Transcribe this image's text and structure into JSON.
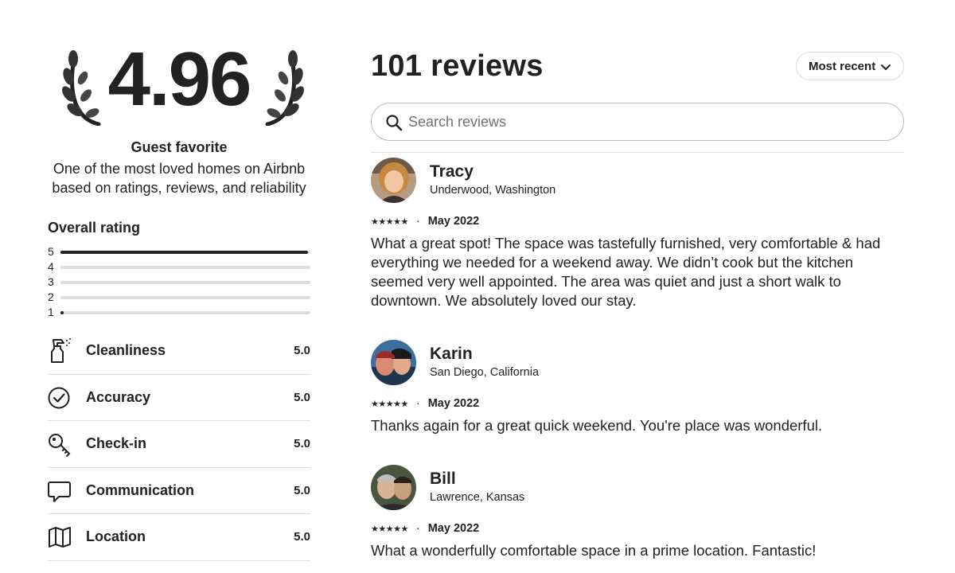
{
  "summary": {
    "rating": "4.96",
    "badge_title": "Guest favorite",
    "badge_description": "One of the most loved homes on Airbnb based on ratings, reviews, and reliability"
  },
  "overall": {
    "title": "Overall rating",
    "distribution": [
      {
        "stars": "5",
        "fraction": 0.99
      },
      {
        "stars": "4",
        "fraction": 0.0
      },
      {
        "stars": "3",
        "fraction": 0.0
      },
      {
        "stars": "2",
        "fraction": 0.0
      },
      {
        "stars": "1",
        "fraction": 0.01
      }
    ]
  },
  "categories": [
    {
      "label": "Cleanliness",
      "score": "5.0",
      "icon": "spray-bottle-icon"
    },
    {
      "label": "Accuracy",
      "score": "5.0",
      "icon": "check-circle-icon"
    },
    {
      "label": "Check-in",
      "score": "5.0",
      "icon": "key-icon"
    },
    {
      "label": "Communication",
      "score": "5.0",
      "icon": "chat-bubble-icon"
    },
    {
      "label": "Location",
      "score": "5.0",
      "icon": "map-icon"
    }
  ],
  "reviews_header": {
    "title": "101 reviews",
    "sort_label": "Most recent"
  },
  "search": {
    "placeholder": "Search reviews",
    "value": ""
  },
  "reviews": [
    {
      "name": "Tracy",
      "location": "Underwood, Washington",
      "stars": "★★★★★",
      "separator": "·",
      "date": "May 2022",
      "text": "What a great spot! The space was tastefully furnished, very comfortable & had everything we needed for a weekend away. We didn’t cook but the kitchen seemed very well appointed. The area was quiet and just a short walk to downtown. We absolutely loved our stay."
    },
    {
      "name": "Karin",
      "location": "San Diego, California",
      "stars": "★★★★★",
      "separator": "·",
      "date": "May 2022",
      "text": "Thanks again for a great quick weekend. You're place was wonderful."
    },
    {
      "name": "Bill",
      "location": "Lawrence, Kansas",
      "stars": "★★★★★",
      "separator": "·",
      "date": "May 2022",
      "text": "What a wonderfully comfortable space in a prime location. Fantastic!"
    }
  ]
}
